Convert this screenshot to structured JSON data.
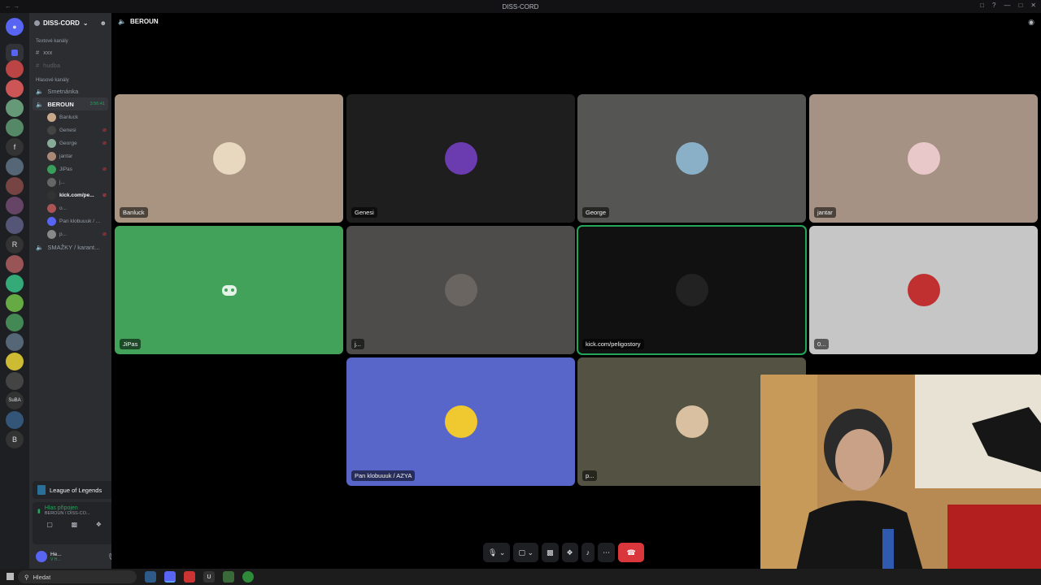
{
  "window": {
    "title": "DISS-CORD"
  },
  "server": {
    "name": "DISS-CORD"
  },
  "channels": {
    "text_category": "Textové kanály",
    "text_items": [
      {
        "label": "xxx"
      },
      {
        "label": "hudba"
      }
    ],
    "voice_category": "Hlasové kanály",
    "voice_1": "Smetnánka",
    "active_voice": "BEROUN",
    "active_duration": "3:56:41",
    "members": [
      {
        "name": "Banluck"
      },
      {
        "name": "Genesi"
      },
      {
        "name": "George"
      },
      {
        "name": "jantar"
      },
      {
        "name": "JiPas"
      },
      {
        "name": "j..."
      },
      {
        "name": "kick.com/pe..."
      },
      {
        "name": "o..."
      },
      {
        "name": "Pan klobuuuk / ..."
      },
      {
        "name": "p..."
      }
    ],
    "voice_last": "SMAŽKY / karant..."
  },
  "activity": {
    "game": "League of Legends"
  },
  "voice_status": {
    "state": "Hlas připojen",
    "sub": "BEROUN / DISS-CO..."
  },
  "user": {
    "name": "He...",
    "status": "V H..."
  },
  "call": {
    "channel": "BEROUN"
  },
  "tiles": [
    {
      "name": "Banluck",
      "bg": "#a99482"
    },
    {
      "name": "Genesi",
      "bg": "#1e1e1e"
    },
    {
      "name": "George",
      "bg": "#555553"
    },
    {
      "name": "jantar",
      "bg": "#a59284"
    },
    {
      "name": "JiPas",
      "bg": "#43a25a"
    },
    {
      "name": "j...",
      "bg": "#4d4c4a"
    },
    {
      "name": "kick.com/peligostory",
      "bg": "#111111"
    },
    {
      "name": "0...",
      "bg": "#c6c6c6"
    },
    {
      "name": "Pan klobuuuk / AZYA",
      "bg": "#5865c9"
    },
    {
      "name": "p...",
      "bg": "#545243"
    }
  ],
  "taskbar": {
    "search_placeholder": "Hledat"
  },
  "colors": {
    "accent": "#5865f2",
    "speaking": "#23a55a",
    "danger": "#da373c"
  }
}
